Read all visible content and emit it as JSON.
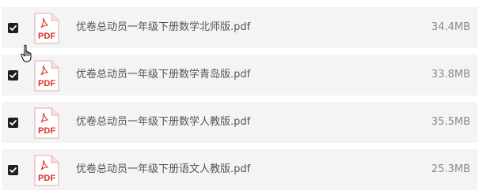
{
  "files": [
    {
      "name": "优卷总动员一年级下册数学北师版.pdf",
      "size": "34.4MB",
      "checked": true,
      "type_label": "PDF",
      "icon": "pdf-file-icon"
    },
    {
      "name": "优卷总动员一年级下册数学青岛版.pdf",
      "size": "33.8MB",
      "checked": true,
      "type_label": "PDF",
      "icon": "pdf-file-icon"
    },
    {
      "name": "优卷总动员一年级下册数学人教版.pdf",
      "size": "35.5MB",
      "checked": true,
      "type_label": "PDF",
      "icon": "pdf-file-icon"
    },
    {
      "name": "优卷总动员一年级下册语文人教版.pdf",
      "size": "25.3MB",
      "checked": true,
      "type_label": "PDF",
      "icon": "pdf-file-icon"
    }
  ],
  "colors": {
    "row_background": "#f4f4f5",
    "pdf_red": "#d9342b",
    "checkbox_fill": "#1f1f1f"
  },
  "cursor": "hand-pointer-icon"
}
